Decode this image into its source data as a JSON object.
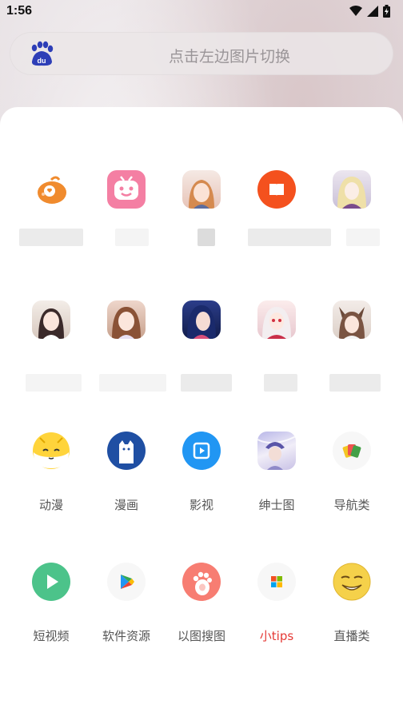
{
  "status_bar": {
    "time": "1:56"
  },
  "search": {
    "placeholder": "点击左边图片切换"
  },
  "grid": {
    "row3": [
      "动漫",
      "漫画",
      "影视",
      "绅士图",
      "导航类"
    ],
    "row4": [
      "短视频",
      "软件资源",
      "以图搜图",
      "小tips",
      "直播类"
    ]
  },
  "colors": {
    "accent_red": "#e53935",
    "label": "#555555"
  }
}
